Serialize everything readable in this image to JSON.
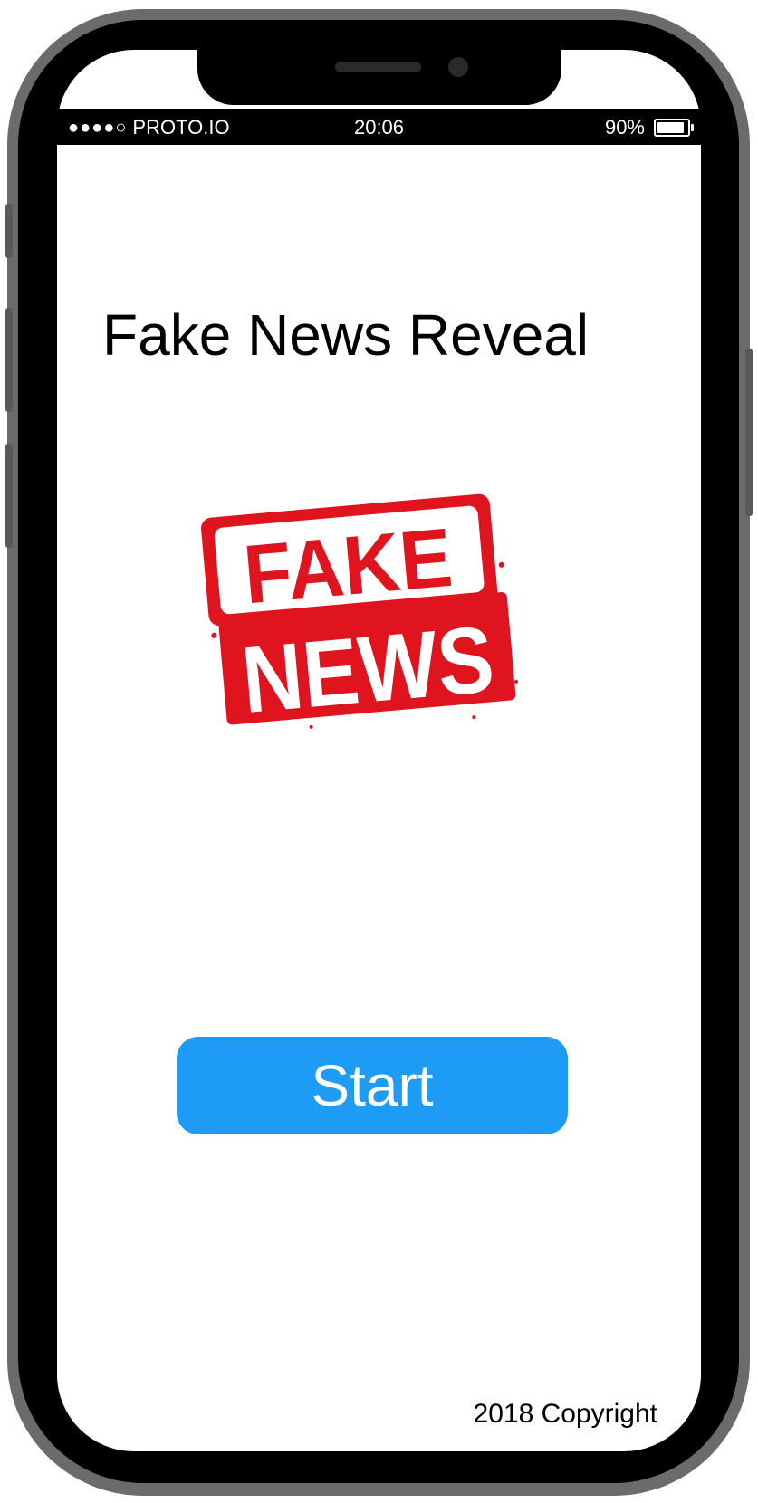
{
  "status_bar": {
    "carrier": "PROTO.IO",
    "signal_dots": "●●●●○",
    "time": "20:06",
    "battery_percent": "90%",
    "battery_level": 0.9
  },
  "app": {
    "title": "Fake News Reveal",
    "logo": {
      "line1": "FAKE",
      "line2": "NEWS",
      "color": "#e0141e"
    },
    "start_button_label": "Start",
    "start_button_color": "#1e9bf5",
    "copyright": "2018 Copyright"
  }
}
